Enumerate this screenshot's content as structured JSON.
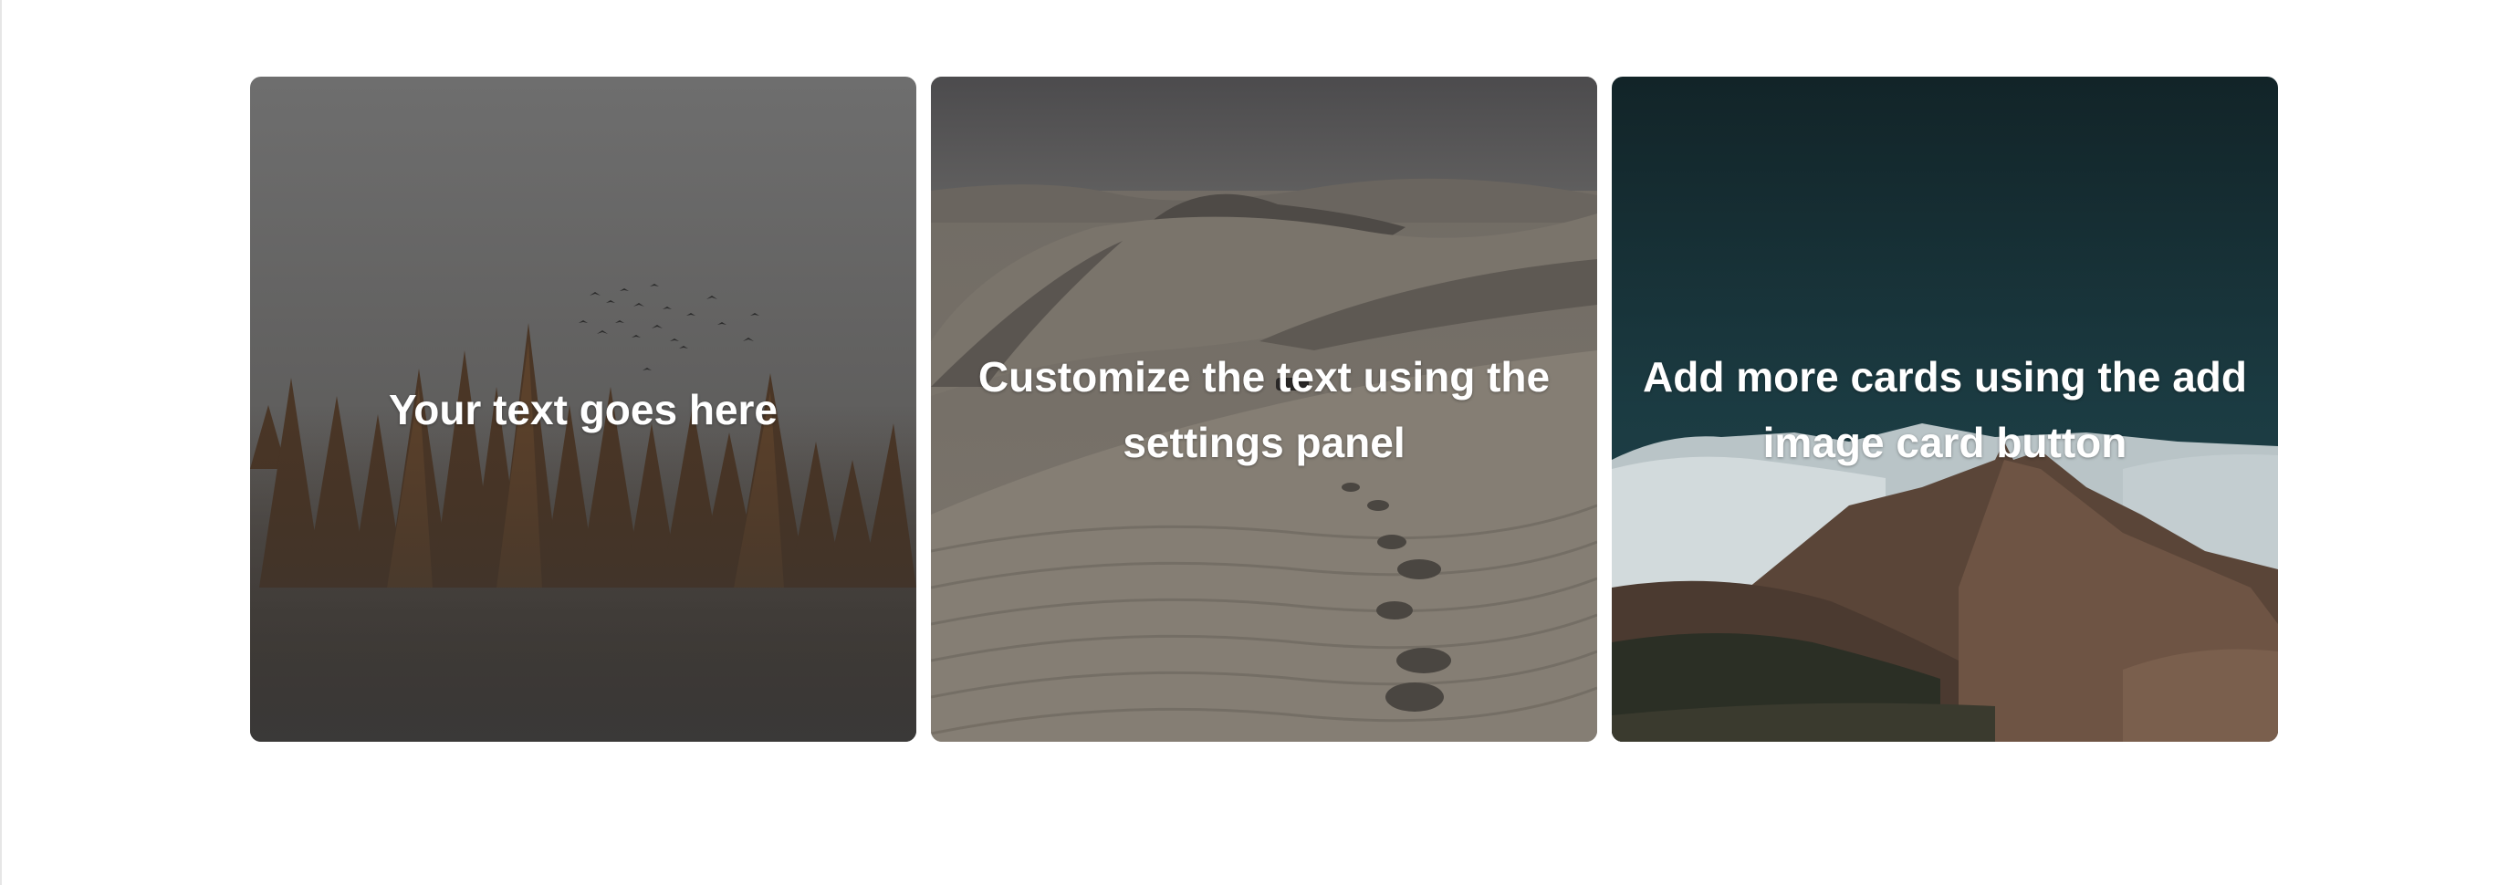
{
  "cards": [
    {
      "text": "Your text goes here",
      "image": "forest-silhouette-birds"
    },
    {
      "text": "Customize the text using the settings panel",
      "image": "desert-dunes-footprints"
    },
    {
      "text": "Add more cards using the add image card button",
      "image": "snowy-mountains-teal-sky"
    }
  ]
}
